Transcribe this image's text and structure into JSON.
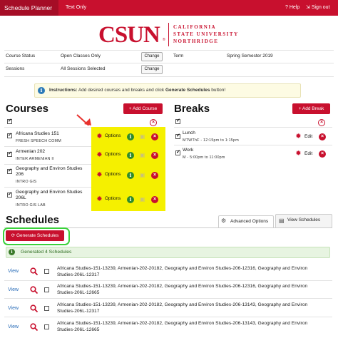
{
  "topbar": {
    "brand": "Schedule Planner",
    "text_only": "Text Only",
    "help": "Help",
    "sign_out": "Sign out"
  },
  "logo": {
    "csun": "CSUN",
    "reg": "®",
    "line1": "CALIFORNIA",
    "line2": "STATE UNIVERSITY",
    "line3": "NORTHRIDGE"
  },
  "filters": {
    "course_status_label": "Course Status",
    "course_status_value": "Open Classes Only",
    "sessions_label": "Sessions",
    "sessions_value": "All Sessions Selected",
    "term_label": "Term",
    "term_value": "Spring Semester 2019",
    "change_label": "Change"
  },
  "instructions": {
    "bold": "Instructions:",
    "text": " Add desired courses and breaks and click ",
    "bold2": "Generate Schedules",
    "tail": " button!"
  },
  "courses": {
    "title": "Courses",
    "add_label": "+ Add Course",
    "options_label": "Options",
    "items": [
      {
        "title": "Africana Studies 151",
        "sub": "FRESH SPEECH COMM"
      },
      {
        "title": "Armenian 202",
        "sub": "INTER ARMENIAN II"
      },
      {
        "title": "Geography and Environ Studies",
        "title2": "206",
        "sub": "INTRO GIS"
      },
      {
        "title": "Geography and Environ Studies",
        "title2": "206L",
        "sub": "INTRO GIS LAB"
      }
    ]
  },
  "breaks": {
    "title": "Breaks",
    "add_label": "+ Add Break",
    "edit_label": "Edit",
    "items": [
      {
        "title": "Lunch",
        "sub": "MTWThF - 12:15pm to 1:15pm"
      },
      {
        "title": "Work",
        "sub": "M - 5:00pm to 11:00pm"
      }
    ]
  },
  "schedules": {
    "title": "Schedules",
    "tab_advanced": "Advanced Options",
    "tab_view": "View Schedules",
    "generate_label": "Generate Schedules",
    "generated_msg": "Generated 4 Schedules",
    "view_label": "View",
    "rows": [
      {
        "l1": "Africana Studies-151-13239, Armenian-202-20182, Geography and Environ Studies-206-12316, Geography and Environ",
        "l2": "Studies-206L-12317"
      },
      {
        "l1": "Africana Studies-151-13239, Armenian-202-20182, Geography and Environ Studies-206-12316, Geography and Environ",
        "l2": "Studies-206L-12665"
      },
      {
        "l1": "Africana Studies-151-13239, Armenian-202-20182, Geography and Environ Studies-206-13143, Geography and Environ",
        "l2": "Studies-206L-12317"
      },
      {
        "l1": "Africana Studies-151-13239, Armenian-202-20182, Geography and Environ Studies-206-13143, Geography and Environ",
        "l2": "Studies-206L-12665"
      }
    ]
  },
  "colors": {
    "brand_red": "#c8102e",
    "highlight_yellow": "#f5f000",
    "ring_green": "#3bd13b",
    "link_blue": "#2a6db8"
  }
}
